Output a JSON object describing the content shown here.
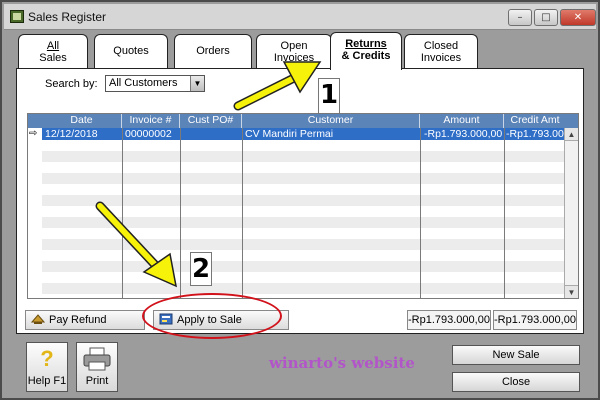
{
  "window": {
    "title": "Sales Register",
    "controls": {
      "minimize": "–",
      "maximize": "□",
      "close": "✕"
    }
  },
  "tabs": [
    {
      "line1": "All",
      "line2": "Sales",
      "underline": "A"
    },
    {
      "line1": "Quotes",
      "line2": "",
      "underline": "Q"
    },
    {
      "line1": "Orders",
      "line2": "",
      "underline": "d"
    },
    {
      "line1": "Open",
      "line2": "Invoices",
      "underline": "p"
    },
    {
      "line1": "Returns",
      "line2": "& Credits",
      "underline": "R",
      "active": true
    },
    {
      "line1": "Closed",
      "line2": "Invoices",
      "underline": "l"
    }
  ],
  "search": {
    "label": "Search by:",
    "selected": "All Customers"
  },
  "table": {
    "columns": [
      "Date",
      "Invoice #",
      "Cust PO#",
      "Customer",
      "Amount",
      "Credit Amt"
    ],
    "rows": [
      {
        "date": "12/12/2018",
        "invoice": "00000002",
        "cust_po": "",
        "customer": "CV Mandiri Permai",
        "amount": "-Rp1.793.000,00",
        "credit_amt": "-Rp1.793.000,00"
      }
    ]
  },
  "buttons": {
    "pay_refund": "Pay Refund",
    "apply_to_sale": "Apply to Sale",
    "new_sale": "New Sale",
    "close": "Close",
    "help": "Help F1",
    "print": "Print"
  },
  "totals": {
    "amount": "-Rp1.793.000,00",
    "credit_amt": "-Rp1.793.000,00"
  },
  "watermark": "winarto's website",
  "annotations": {
    "step1": "1",
    "step2": "2",
    "arrow_color": "#f7f20a",
    "circle_color": "#d1121b"
  },
  "colors": {
    "header_blue": "#5b84b9",
    "selection_blue": "#2f6ec7"
  }
}
